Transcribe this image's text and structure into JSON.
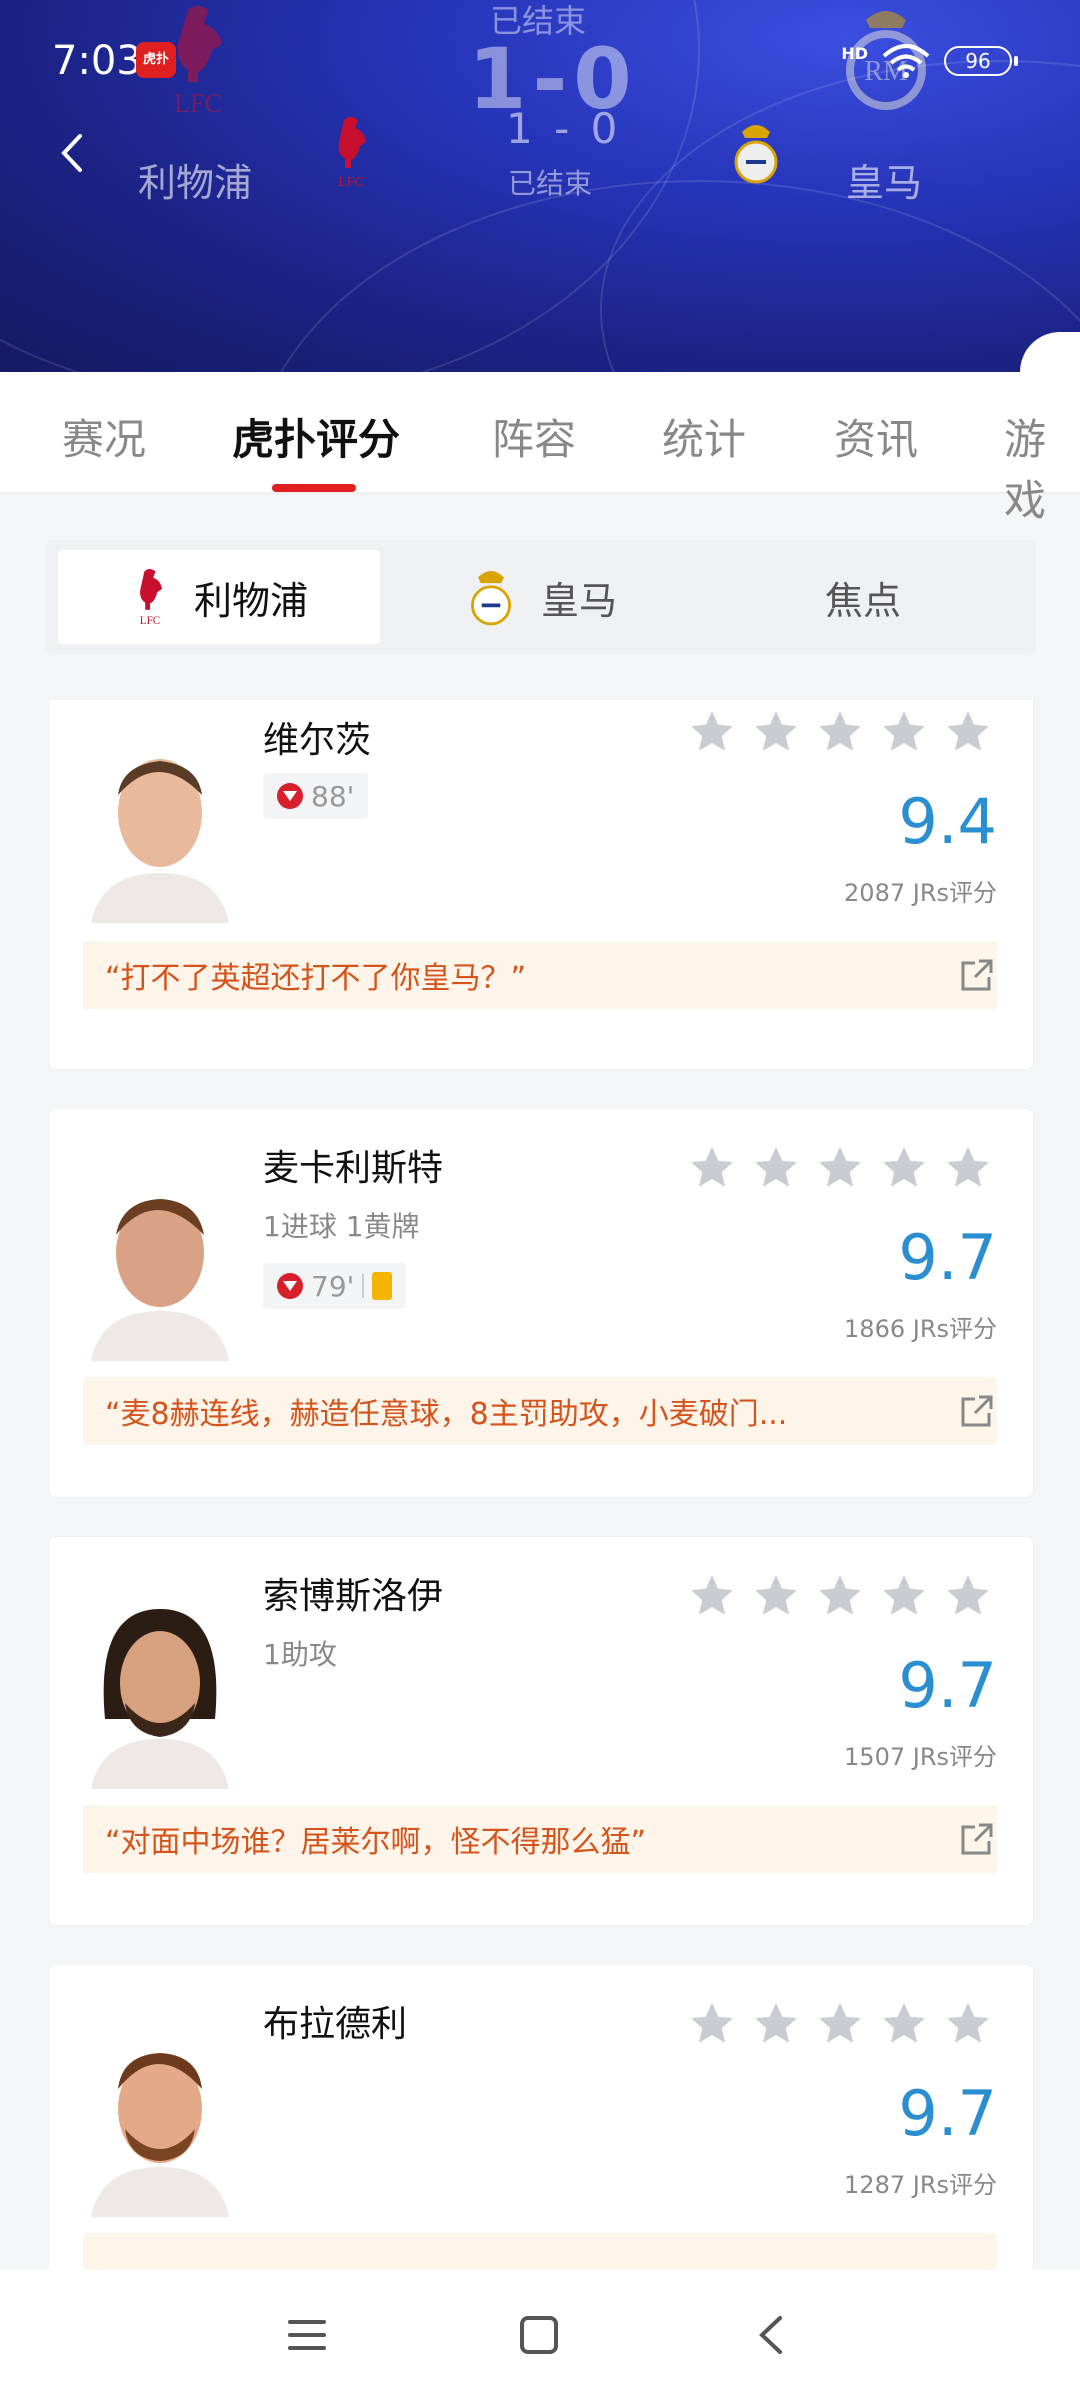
{
  "status_bar": {
    "time": "7:03",
    "app_badge": "虎扑",
    "network": "HD",
    "battery": "96"
  },
  "match": {
    "status_top": "已结束",
    "big_score": "1-0",
    "home_team": "利物浦",
    "away_team": "皇马",
    "score": "1 - 0",
    "status": "已结束"
  },
  "tabs": [
    {
      "label": "赛况"
    },
    {
      "label": "虎扑评分"
    },
    {
      "label": "阵容"
    },
    {
      "label": "统计"
    },
    {
      "label": "资讯"
    },
    {
      "label": "游戏"
    }
  ],
  "team_switch": [
    {
      "label": "利物浦",
      "icon": "liverpool-crest-icon"
    },
    {
      "label": "皇马",
      "icon": "real-madrid-crest-icon"
    },
    {
      "label": "焦点"
    }
  ],
  "players": [
    {
      "name": "维尔茨",
      "stats": "",
      "sub_minute": "88'",
      "yellow_card": false,
      "score": "9.4",
      "votes": "2087 JRs评分",
      "quote": "“打不了英超还打不了你皇马？”",
      "stars": 5
    },
    {
      "name": "麦卡利斯特",
      "stats": "1进球 1黄牌",
      "sub_minute": "79'",
      "yellow_card": true,
      "score": "9.7",
      "votes": "1866 JRs评分",
      "quote": "“麦8赫连线，赫造任意球，8主罚助攻，小麦破门...",
      "stars": 5
    },
    {
      "name": "索博斯洛伊",
      "stats": "1助攻",
      "sub_minute": "",
      "yellow_card": false,
      "score": "9.7",
      "votes": "1507 JRs评分",
      "quote": "“对面中场谁？居莱尔啊，怪不得那么猛”",
      "stars": 5
    },
    {
      "name": "布拉德利",
      "stats": "",
      "sub_minute": "",
      "yellow_card": false,
      "score": "9.7",
      "votes": "1287 JRs评分",
      "quote": "",
      "stars": 5
    }
  ],
  "colors": {
    "accent": "#e02020",
    "score_blue": "#2a8fd1",
    "quote_text": "#d4541b",
    "header_bg": "#2634b8"
  },
  "nav": [
    "menu-icon",
    "home-icon",
    "back-icon"
  ]
}
